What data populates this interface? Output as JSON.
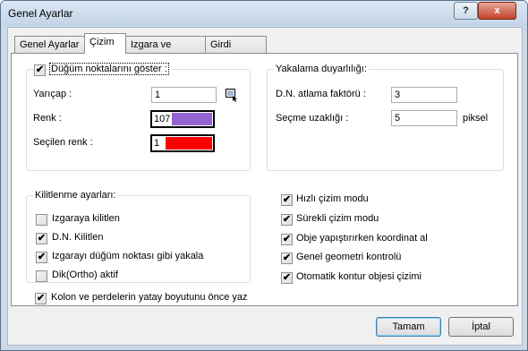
{
  "window": {
    "title": "Genel Ayarlar",
    "help_glyph": "?",
    "close_glyph": "x"
  },
  "tabs": [
    {
      "label": "Genel Ayarlar",
      "active": false
    },
    {
      "label": "Çizim",
      "active": true
    },
    {
      "label": "Izgara ve Sınırlar",
      "active": false
    },
    {
      "label": "Girdi Birimleri",
      "active": false
    }
  ],
  "node_group": {
    "legend": "Düğüm noktalarını göster :",
    "checked": true,
    "radius": {
      "label": "Yarıçap :",
      "value": "1"
    },
    "color": {
      "label": "Renk :",
      "value": "107",
      "swatch": "#9463d0"
    },
    "selected_color": {
      "label": "Seçilen renk :",
      "value": "1",
      "swatch": "#ff0000"
    },
    "picker_icon": "cursor-picker-icon"
  },
  "snap_group": {
    "legend": "Yakalama  duyarlılığı:",
    "skip_factor": {
      "label": "D.N. atlama faktörü :",
      "value": "3"
    },
    "selection_distance": {
      "label": "Seçme uzaklığı :",
      "value": "5",
      "unit": "piksel"
    }
  },
  "lock_group": {
    "legend": "Kilitlenme ayarları:",
    "items": [
      {
        "label": "Izgaraya kilitlen",
        "checked": false
      },
      {
        "label": "D.N. Kilitlen",
        "checked": true
      },
      {
        "label": "Izgarayı düğüm noktası gibi yakala",
        "checked": true
      },
      {
        "label": "Dik(Ortho) aktif",
        "checked": false
      }
    ]
  },
  "column_option": {
    "label": "Kolon ve perdelerin yatay boyutunu önce yaz",
    "checked": true
  },
  "mode_options": [
    {
      "label": "Hızlı çizim modu",
      "checked": true
    },
    {
      "label": "Sürekli çizim modu",
      "checked": true
    },
    {
      "label": "Obje yapıştırırken koordinat al",
      "checked": true
    },
    {
      "label": "Genel geometri kontrolü",
      "checked": true
    },
    {
      "label": "Otomatik kontur objesi çizimi",
      "checked": true
    }
  ],
  "buttons": {
    "ok": "Tamam",
    "cancel": "İptal"
  }
}
